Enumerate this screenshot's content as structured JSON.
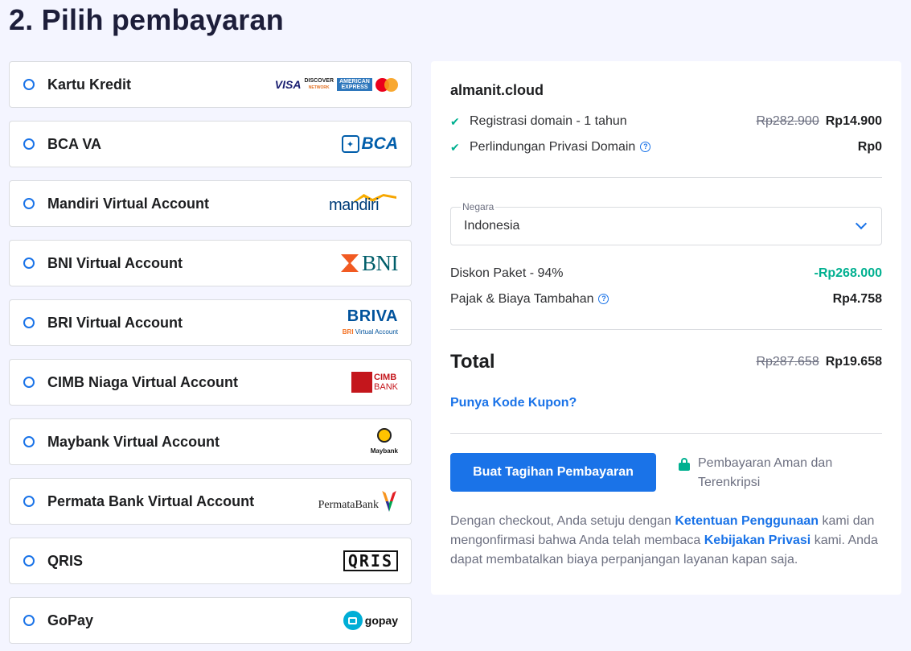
{
  "page": {
    "title": "2. Pilih pembayaran"
  },
  "methods": [
    {
      "label": "Kartu Kredit",
      "logo_name": "card-networks-logo",
      "logo_text": [
        "VISA",
        "DISCOVER",
        "NETWORK",
        "AMERICAN EXPRESS"
      ]
    },
    {
      "label": "BCA VA",
      "logo_name": "bca-logo",
      "logo_text": "BCA"
    },
    {
      "label": "Mandiri Virtual Account",
      "logo_name": "mandiri-logo",
      "logo_text": "mandiri"
    },
    {
      "label": "BNI Virtual Account",
      "logo_name": "bni-logo",
      "logo_text": "BNI"
    },
    {
      "label": "BRI Virtual Account",
      "logo_name": "briva-logo",
      "logo_text": [
        "BRIVA",
        "BRI",
        "Virtual Account"
      ]
    },
    {
      "label": "CIMB Niaga Virtual Account",
      "logo_name": "cimb-logo",
      "logo_text": [
        "CIMB",
        "BANK"
      ]
    },
    {
      "label": "Maybank Virtual Account",
      "logo_name": "maybank-logo",
      "logo_text": "Maybank"
    },
    {
      "label": "Permata Bank Virtual Account",
      "logo_name": "permatabank-logo",
      "logo_text": "PermataBank"
    },
    {
      "label": "QRIS",
      "logo_name": "qris-logo",
      "logo_text": "QRIS"
    },
    {
      "label": "GoPay",
      "logo_name": "gopay-logo",
      "logo_text": "gopay"
    }
  ],
  "summary": {
    "domain": "almanit.cloud",
    "items": [
      {
        "label": "Registrasi domain - 1 tahun",
        "old_price": "Rp282.900",
        "price": "Rp14.900"
      },
      {
        "label": "Perlindungan Privasi Domain",
        "price": "Rp0"
      }
    ],
    "country": {
      "label": "Negara",
      "value": "Indonesia"
    },
    "discount": {
      "label": "Diskon Paket - 94%",
      "value": "-Rp268.000"
    },
    "tax": {
      "label": "Pajak & Biaya Tambahan",
      "value": "Rp4.758"
    },
    "total": {
      "label": "Total",
      "old_price": "Rp287.658",
      "price": "Rp19.658"
    },
    "coupon_link": "Punya Kode Kupon?",
    "pay_button": "Buat Tagihan Pembayaran",
    "secure_text": "Pembayaran Aman dan Terenkripsi",
    "terms": {
      "part1": "Dengan checkout, Anda setuju dengan ",
      "link1": "Ketentuan Penggunaan",
      "part2": " kami dan mengonfirmasi bahwa Anda telah membaca ",
      "link2": "Kebijakan Privasi",
      "part3": " kami. Anda dapat membatalkan biaya perpanjangan layanan kapan saja."
    }
  },
  "colors": {
    "accent": "#1a73e8",
    "success": "#00b090",
    "background": "#f4f5ff"
  }
}
